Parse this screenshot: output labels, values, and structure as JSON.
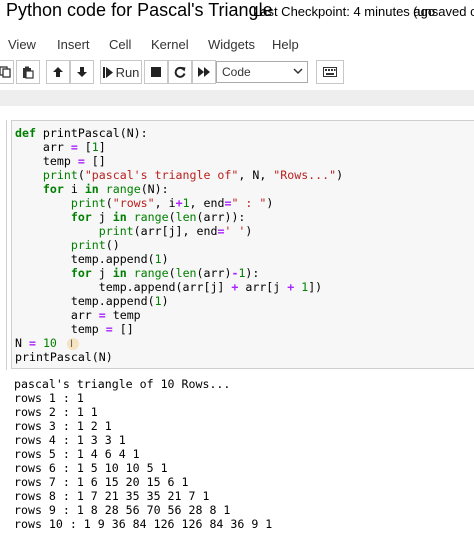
{
  "header": {
    "title": "Python code for Pascal's Triangle",
    "checkpoint": "Last Checkpoint: 4 minutes ago",
    "unsaved": "(unsaved c"
  },
  "menu": {
    "items": [
      "View",
      "Insert",
      "Cell",
      "Kernel",
      "Widgets",
      "Help"
    ]
  },
  "toolbar": {
    "run_label": "Run",
    "cell_type": "Code",
    "icons": [
      "copy-icon",
      "paste-icon",
      "arrow-up-icon",
      "arrow-down-icon",
      "run-icon",
      "stop-icon",
      "restart-icon",
      "fast-forward-icon",
      "keyboard-icon"
    ]
  },
  "cell": {
    "code_lines": [
      "def printPascal(N):",
      "    arr = [1]",
      "    temp = []",
      "    print(\"pascal's triangle of\", N, \"Rows...\")",
      "    for i in range(N):",
      "        print(\"rows\", i+1, end=\" : \")",
      "        for j in range(len(arr)):",
      "            print(arr[j], end=' ')",
      "        print()",
      "        temp.append(1)",
      "        for j in range(len(arr)-1):",
      "            temp.append(arr[j] + arr[j + 1])",
      "        temp.append(1)",
      "        arr = temp",
      "        temp = []",
      "N = 10",
      "printPascal(N)"
    ],
    "output_lines": [
      "pascal's triangle of 10 Rows...",
      "rows 1 : 1",
      "rows 2 : 1 1",
      "rows 3 : 1 2 1",
      "rows 4 : 1 3 3 1",
      "rows 5 : 1 4 6 4 1",
      "rows 6 : 1 5 10 10 5 1",
      "rows 7 : 1 6 15 20 15 6 1",
      "rows 8 : 1 7 21 35 35 21 7 1",
      "rows 9 : 1 8 28 56 70 56 28 8 1",
      "rows 10 : 1 9 36 84 126 126 84 36 9 1"
    ]
  }
}
